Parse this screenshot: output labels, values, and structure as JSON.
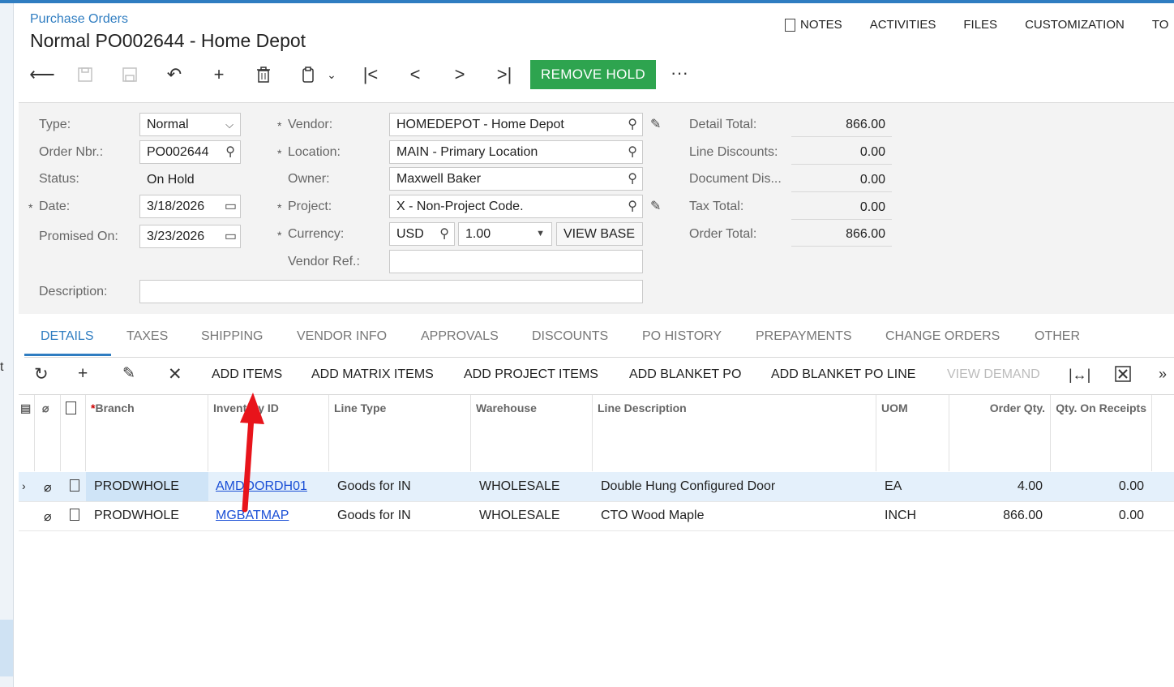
{
  "header": {
    "breadcrumb": "Purchase Orders",
    "title": "Normal PO002644 - Home Depot",
    "links": [
      "NOTES",
      "ACTIVITIES",
      "FILES",
      "CUSTOMIZATION",
      "TO"
    ]
  },
  "toolbar": {
    "remove_hold": "REMOVE HOLD",
    "more": "···",
    "accent_color": "#2ea44f"
  },
  "form": {
    "type_label": "Type:",
    "type_value": "Normal",
    "order_label": "Order Nbr.:",
    "order_value": "PO002644",
    "status_label": "Status:",
    "status_value": "On Hold",
    "date_label": "Date:",
    "date_value": "3/18/2026",
    "promised_label": "Promised On:",
    "promised_value": "3/23/2026",
    "description_label": "Description:",
    "description_value": "",
    "vendor_label": "Vendor:",
    "vendor_value": "HOMEDEPOT - Home Depot",
    "location_label": "Location:",
    "location_value": "MAIN - Primary Location",
    "owner_label": "Owner:",
    "owner_value": "Maxwell Baker",
    "project_label": "Project:",
    "project_value": "X - Non-Project Code.",
    "currency_label": "Currency:",
    "currency_value": "USD",
    "rate_value": "1.00",
    "view_base": "VIEW BASE",
    "vendor_ref_label": "Vendor Ref.:",
    "vendor_ref_value": ""
  },
  "summary": {
    "detail_total_label": "Detail Total:",
    "detail_total": "866.00",
    "line_discounts_label": "Line Discounts:",
    "line_discounts": "0.00",
    "document_dis_label": "Document Dis...",
    "document_dis": "0.00",
    "tax_total_label": "Tax Total:",
    "tax_total": "0.00",
    "order_total_label": "Order Total:",
    "order_total": "866.00"
  },
  "tabs": [
    "DETAILS",
    "TAXES",
    "SHIPPING",
    "VENDOR INFO",
    "APPROVALS",
    "DISCOUNTS",
    "PO HISTORY",
    "PREPAYMENTS",
    "CHANGE ORDERS",
    "OTHER"
  ],
  "grid_toolbar": {
    "add_items": "ADD ITEMS",
    "add_matrix_items": "ADD MATRIX ITEMS",
    "add_project_items": "ADD PROJECT ITEMS",
    "add_blanket_po": "ADD BLANKET PO",
    "add_blanket_po_line": "ADD BLANKET PO LINE",
    "view_demand": "VIEW DEMAND"
  },
  "grid": {
    "columns": [
      "Branch",
      "Inventory ID",
      "Line Type",
      "Warehouse",
      "Line Description",
      "UOM",
      "Order Qty.",
      "Qty. On Receipts"
    ],
    "rows": [
      {
        "branch": "PRODWHOLE",
        "inventory_id": "AMDOORDH01",
        "line_type": "Goods for IN",
        "warehouse": "WHOLESALE",
        "description": "Double Hung Configured Door",
        "uom": "EA",
        "order_qty": "4.00",
        "qty_on_receipts": "0.00"
      },
      {
        "branch": "PRODWHOLE",
        "inventory_id": "MGBATMAP",
        "line_type": "Goods for IN",
        "warehouse": "WHOLESALE",
        "description": "CTO Wood Maple",
        "uom": "INCH",
        "order_qty": "866.00",
        "qty_on_receipts": "0.00"
      }
    ]
  },
  "leftstrip": {
    "letter": "t"
  }
}
